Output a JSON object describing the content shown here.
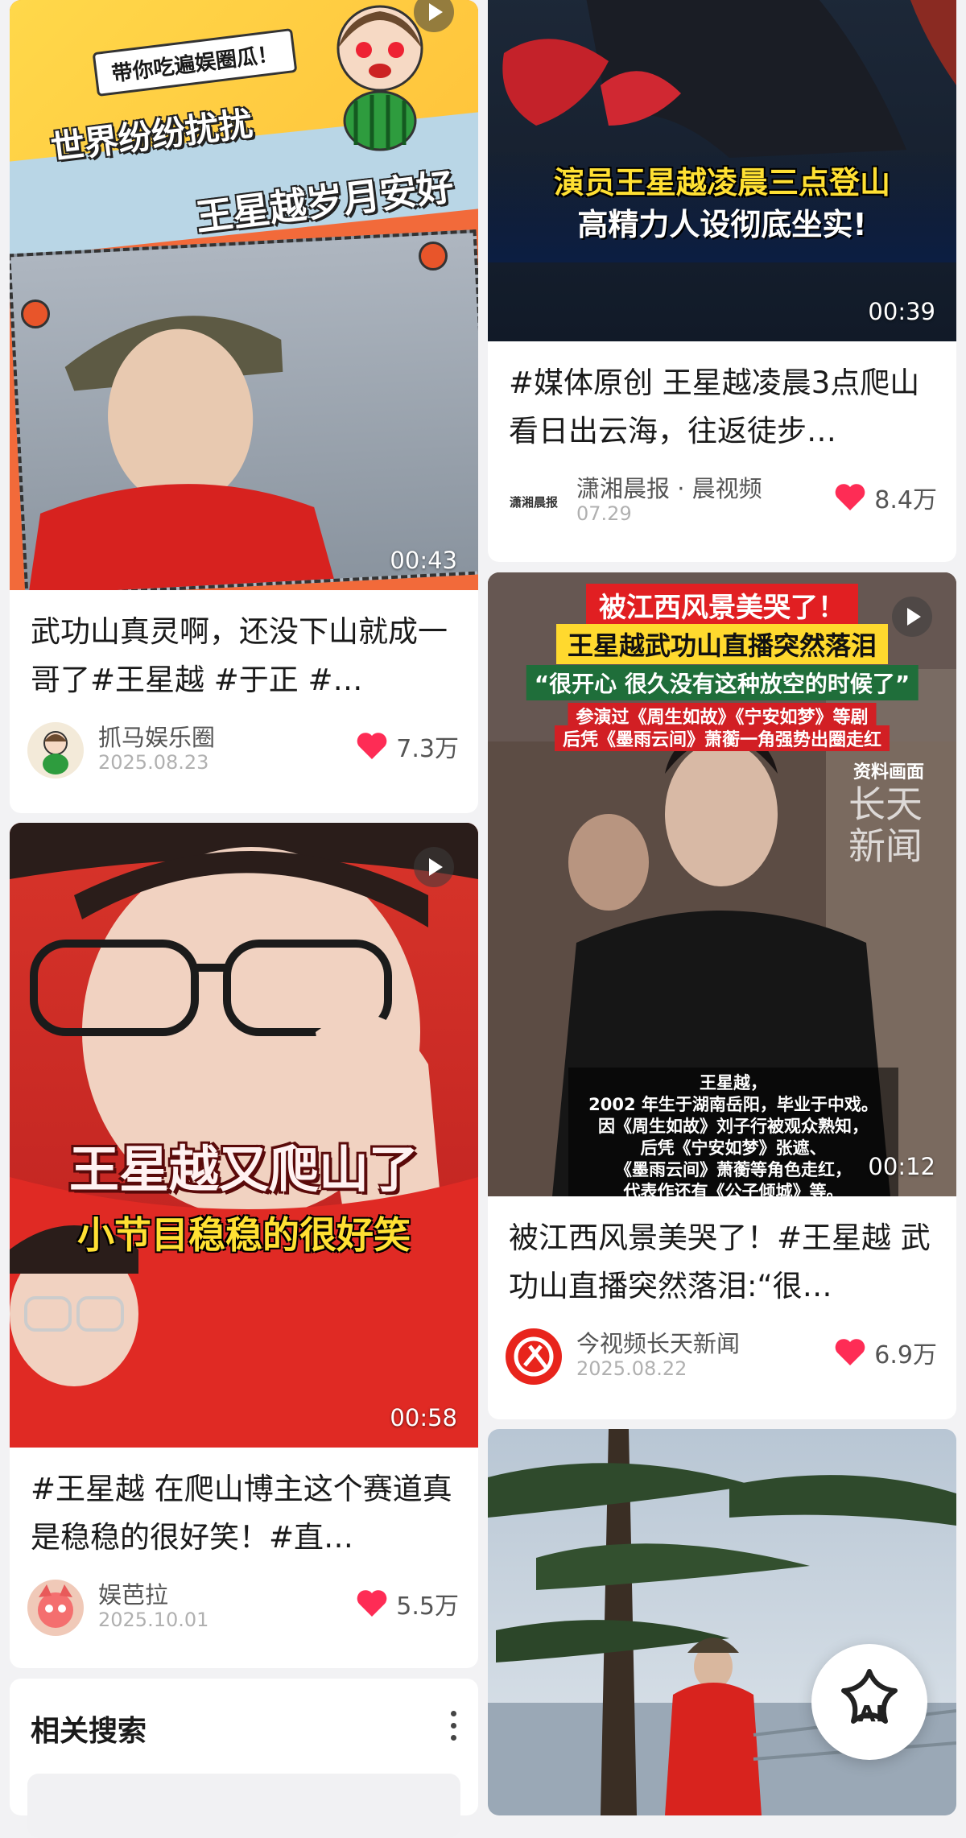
{
  "feed": {
    "left": [
      {
        "overlay_lines": [
          "带你吃遍娱圈瓜！",
          "世界纷纷扰扰",
          "王星越岁月安好"
        ],
        "duration": "00:43",
        "title": "武功山真灵啊，还没下山就成一哥了#王星越 #于正 #…",
        "author": "抓马娱乐圈",
        "date": "2025.08.23",
        "likes": "7.3万"
      },
      {
        "overlay_lines": [
          "王星越又爬山了",
          "小节目稳稳的很好笑"
        ],
        "duration": "00:58",
        "title": "#王星越 在爬山博主这个赛道真是稳稳的很好笑！#直…",
        "author": "娱芭拉",
        "date": "2025.10.01",
        "likes": "5.5万"
      }
    ],
    "right": [
      {
        "overlay_lines": [
          "演员王星越凌晨三点登山",
          "高精力人设彻底坐实!"
        ],
        "duration": "00:39",
        "title": "#媒体原创 王星越凌晨3点爬山看日出云海，往返徒步…",
        "author": "潇湘晨报 · 晨视频",
        "avatar_text": "潇湘晨报",
        "date": "07.29",
        "likes": "8.4万"
      },
      {
        "overlay_lines": [
          "被江西风景美哭了！",
          "王星越武功山直播突然落泪",
          "“很开心 很久没有这种放空的时候了”",
          "参演过《周生如故》《宁安如梦》等剧",
          "后凭《墨雨云间》萧蘅一角强势出圈走红",
          "资料画面",
          "长天",
          "新闻",
          "王星越，",
          "2002 年生于湖南岳阳，毕业于中戏。",
          "因《周生如故》刘子行被观众熟知，",
          "后凭《宁安如梦》张遮、",
          "《墨雨云间》萧蘅等角色走红，",
          "代表作还有《公子倾城》等。"
        ],
        "duration": "00:12",
        "title": "被江西风景美哭了！#王星越 武功山直播突然落泪:“很…",
        "author": "今视频长天新闻",
        "date": "2025.08.22",
        "likes": "6.9万"
      }
    ]
  },
  "related": {
    "title": "相关搜索"
  },
  "ai_button": {
    "label": "AI"
  },
  "colors": {
    "accent_red": "#fe2c55",
    "likes_heart": "#fe2c55"
  }
}
